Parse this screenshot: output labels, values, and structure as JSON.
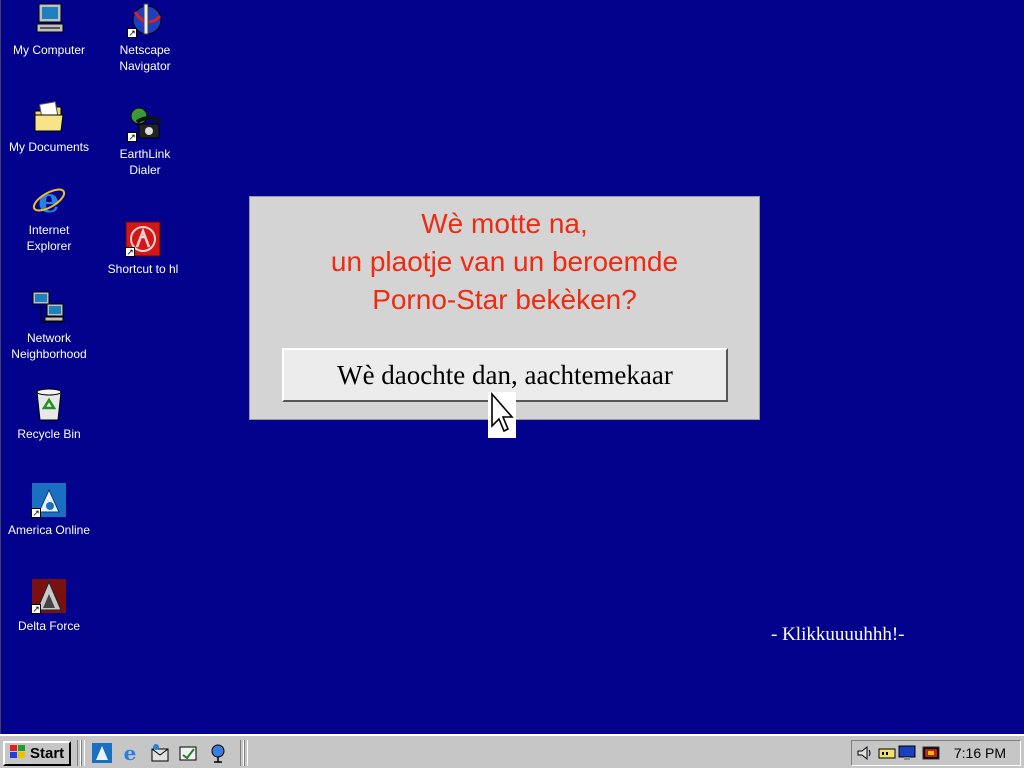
{
  "desktop_icons": [
    {
      "name": "my-computer",
      "label": "My Computer",
      "icon": "computer-icon"
    },
    {
      "name": "netscape-navigator",
      "label_lines": [
        "Netscape",
        "Navigator"
      ],
      "icon": "netscape-icon"
    },
    {
      "name": "my-documents",
      "label": "My Documents",
      "icon": "folder-icon"
    },
    {
      "name": "earthlink-dialer",
      "label_lines": [
        "EarthLink",
        "Dialer"
      ],
      "icon": "phone-icon"
    },
    {
      "name": "internet-explorer",
      "label_lines": [
        "Internet",
        "Explorer"
      ],
      "icon": "ie-icon"
    },
    {
      "name": "shortcut-to-hl",
      "label": "Shortcut to hl",
      "icon": "half-life-icon"
    },
    {
      "name": "network-neighborhood",
      "label_lines": [
        "Network",
        "Neighborhood"
      ],
      "icon": "network-icon"
    },
    {
      "name": "recycle-bin",
      "label": "Recycle Bin",
      "icon": "recycle-bin-icon"
    },
    {
      "name": "america-online",
      "label": "America Online",
      "icon": "aol-icon"
    },
    {
      "name": "delta-force",
      "label": "Delta Force",
      "icon": "delta-force-icon"
    }
  ],
  "dialog": {
    "message_lines": [
      "Wè motte na,",
      "un plaotje van un beroemde",
      "Porno-Star bekèken?"
    ],
    "button_label": "Wè daochte dan, aachtemekaar",
    "message_color": "#f02a10"
  },
  "desktop_caption": "- Klikkuuuuhhh!-",
  "taskbar": {
    "start_label": "Start",
    "quick_launch": [
      "aol-icon",
      "ie-icon",
      "outlook-icon",
      "show-desktop-icon",
      "channels-icon"
    ],
    "tray_icons": [
      "speaker-icon",
      "modem-icon",
      "monitor-icon",
      "scheduler-icon"
    ],
    "clock": "7:16 PM"
  },
  "colors": {
    "desktop": "#02028c",
    "taskbar": "#c6c6c6",
    "dialog": "#d4d4d4"
  }
}
